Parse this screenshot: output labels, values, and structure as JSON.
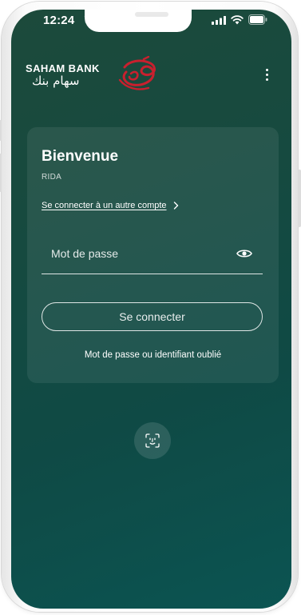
{
  "status_bar": {
    "time": "12:24"
  },
  "header": {
    "logo_text_latin": "SAHAM BANK",
    "logo_text_arabic": "سهام بنك",
    "brand_mark_color": "#c8202e"
  },
  "card": {
    "title": "Bienvenue",
    "username": "RIDA",
    "switch_account_label": "Se connecter à un autre compte",
    "password_placeholder": "Mot de passe",
    "login_button_label": "Se connecter",
    "forgot_link_label": "Mot de passe ou identifiant oublié"
  },
  "icons": {
    "status": [
      "bell-slash-icon",
      "signal-icon",
      "wifi-icon",
      "battery-icon"
    ],
    "menu": "more-vertical-icon",
    "switch_account": "chevron-right-icon",
    "password_toggle": "eye-icon",
    "biometric": "face-id-icon"
  },
  "colors": {
    "background_start": "#1c4a3b",
    "background_end": "#0b5452",
    "text": "#ffffff"
  }
}
